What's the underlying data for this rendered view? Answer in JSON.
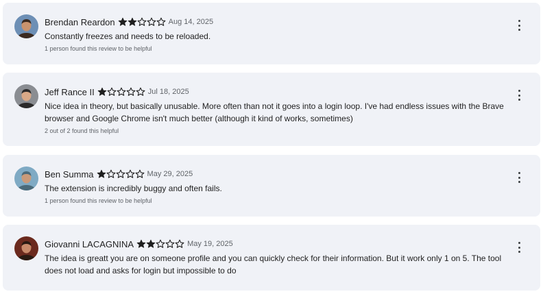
{
  "reviews": [
    {
      "author": "Brendan Reardon",
      "rating": 2,
      "date": "Aug 14, 2025",
      "text": "Constantly freezes and needs to be reloaded.",
      "helpful": "1 person found this review to be helpful",
      "avatar_colors": {
        "bg": "#6d8fb5",
        "skin": "#c9936e",
        "hair": "#3b2a20"
      }
    },
    {
      "author": "Jeff Rance II",
      "rating": 1,
      "date": "Jul 18, 2025",
      "text": "Nice idea in theory, but basically unusable. More often than not it goes into a login loop. I've had endless issues with the Brave browser and Google Chrome isn't much better (although it kind of works, sometimes)",
      "helpful": "2 out of 2 found this helpful",
      "avatar_colors": {
        "bg": "#8a8d92",
        "skin": "#d8a887",
        "hair": "#2b2a2a"
      }
    },
    {
      "author": "Ben Summa",
      "rating": 1,
      "date": "May 29, 2025",
      "text": "The extension is incredibly buggy and often fails.",
      "helpful": "1 person found this review to be helpful",
      "avatar_colors": {
        "bg": "#7faac4",
        "skin": "#c99a7a",
        "hair": "#4a6a7a"
      }
    },
    {
      "author": "Giovanni LACAGNINA",
      "rating": 2,
      "date": "May 19, 2025",
      "text": "The idea is greatt you are on someone profile and you can quickly check for their information. But it work only 1 on 5. The tool does not load and asks for login but impossible to do",
      "helpful": "",
      "avatar_colors": {
        "bg": "#6b2a1e",
        "skin": "#c88a6a",
        "hair": "#2a1a12"
      }
    }
  ],
  "star_colors": {
    "filled": "#1f1f1f",
    "empty": "#1f1f1f"
  },
  "icons": {
    "menu": "more-vert-icon",
    "star_filled": "star-filled-icon",
    "star_empty": "star-outline-icon"
  }
}
